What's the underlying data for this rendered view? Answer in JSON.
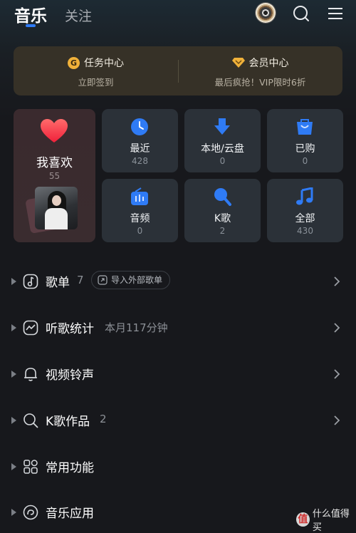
{
  "header": {
    "tabs": [
      {
        "label": "音乐",
        "active": true
      },
      {
        "label": "关注",
        "active": false
      }
    ],
    "icons": [
      "disc-icon",
      "search-icon",
      "menu-icon"
    ]
  },
  "promo": {
    "left": {
      "title": "任务中心",
      "subtitle": "立即签到",
      "badge": "G"
    },
    "right": {
      "title": "会员中心",
      "subtitle": "最后疯抢！VIP限时6折"
    }
  },
  "favorites": {
    "label": "我喜欢",
    "count": "55"
  },
  "tiles": [
    {
      "label": "最近",
      "count": "428",
      "icon": "clock-icon"
    },
    {
      "label": "本地/云盘",
      "count": "0",
      "icon": "download-icon"
    },
    {
      "label": "已购",
      "count": "0",
      "icon": "bag-icon"
    },
    {
      "label": "音频",
      "count": "0",
      "icon": "radio-icon"
    },
    {
      "label": "K歌",
      "count": "2",
      "icon": "microphone-icon"
    },
    {
      "label": "全部",
      "count": "430",
      "icon": "music-note-icon"
    }
  ],
  "rows": [
    {
      "label": "歌单",
      "extra": "7",
      "pill": "导入外部歌单",
      "icon": "playlist-icon"
    },
    {
      "label": "听歌统计",
      "extra": "本月117分钟",
      "icon": "stats-icon"
    },
    {
      "label": "视频铃声",
      "extra": "",
      "icon": "bell-icon"
    },
    {
      "label": "K歌作品",
      "extra": "2",
      "icon": "search-note-icon"
    },
    {
      "label": "常用功能",
      "extra": "",
      "icon": "grid-icon"
    },
    {
      "label": "音乐应用",
      "extra": "",
      "icon": "app-icon"
    }
  ],
  "watermark": {
    "badge": "值",
    "text": "什么值得买"
  },
  "colors": {
    "background": "#17181c",
    "accent": "#2f7bf5",
    "tile": "#2b3138",
    "promo": "#363127",
    "heart": "#ff3b4b",
    "gold": "#f0b13a"
  }
}
